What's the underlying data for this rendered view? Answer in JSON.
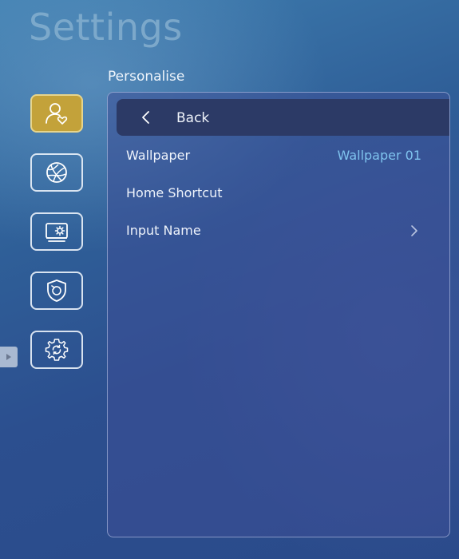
{
  "header": {
    "title": "Settings"
  },
  "section": {
    "label": "Personalise"
  },
  "sidebar": {
    "items": [
      {
        "name": "personalise",
        "icon": "user-heart-icon",
        "active": true
      },
      {
        "name": "network",
        "icon": "globe-icon",
        "active": false
      },
      {
        "name": "display",
        "icon": "monitor-gear-icon",
        "active": false
      },
      {
        "name": "security",
        "icon": "shield-refresh-icon",
        "active": false
      },
      {
        "name": "system",
        "icon": "gear-refresh-icon",
        "active": false
      }
    ]
  },
  "panel": {
    "back_label": "Back",
    "rows": [
      {
        "label": "Wallpaper",
        "value": "Wallpaper 01"
      },
      {
        "label": "Home Shortcut",
        "value": ""
      },
      {
        "label": "Input Name",
        "value": ""
      }
    ]
  },
  "colors": {
    "accent_value": "#7fc3ee",
    "active_tab": "#c3a23a",
    "back_row_bg": "#2c3a66"
  }
}
